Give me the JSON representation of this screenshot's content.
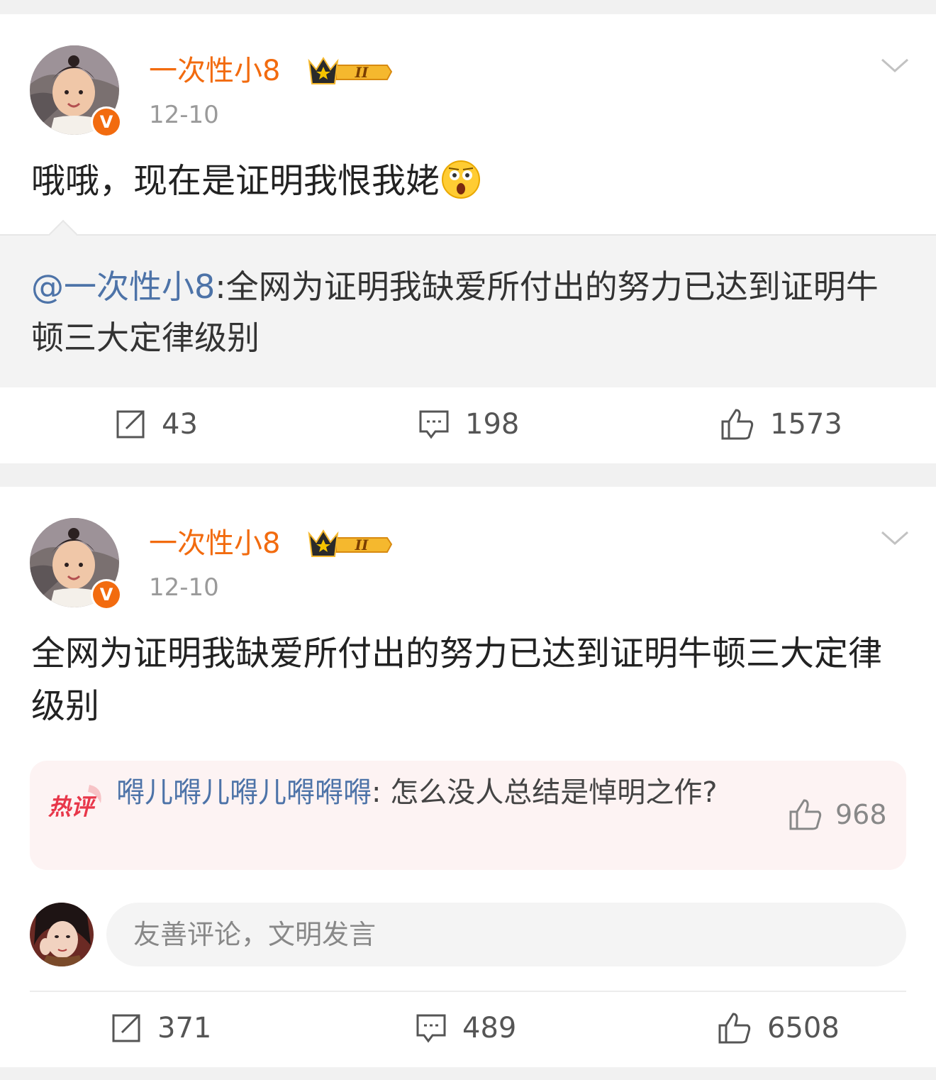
{
  "posts": [
    {
      "username": "一次性小8",
      "vip_level": "II",
      "time": "12-10",
      "content": "哦哦，现在是证明我恨我姥",
      "emoji": "surprised-face",
      "repost": {
        "mention": "@一次性小8",
        "text": ":全网为证明我缺爱所付出的努力已达到证明牛顿三大定律级别"
      },
      "stats": {
        "reposts": "43",
        "comments": "198",
        "likes": "1573"
      }
    },
    {
      "username": "一次性小8",
      "vip_level": "II",
      "time": "12-10",
      "content": "全网为证明我缺爱所付出的努力已达到证明牛顿三大定律级别",
      "hot_comment": {
        "tag": "热评",
        "user": "嘚儿嘚儿嘚儿嘚嘚嘚",
        "text": ": 怎么没人总结是悼明之作?",
        "likes": "968"
      },
      "comment_input": {
        "placeholder": "友善评论，文明发言"
      },
      "stats": {
        "reposts": "371",
        "comments": "489",
        "likes": "6508"
      }
    }
  ],
  "colors": {
    "username": "#f26b0f",
    "mention": "#4d73a8",
    "hot_bg": "#fdf3f3",
    "hot_tag": "#e8374a",
    "page_bg": "#f1f1f1"
  },
  "icons": [
    "more-chevron-icon",
    "repost-icon",
    "comment-icon",
    "like-icon",
    "verified-badge-icon",
    "vip-crown-icon",
    "hot-comment-tag-icon"
  ]
}
